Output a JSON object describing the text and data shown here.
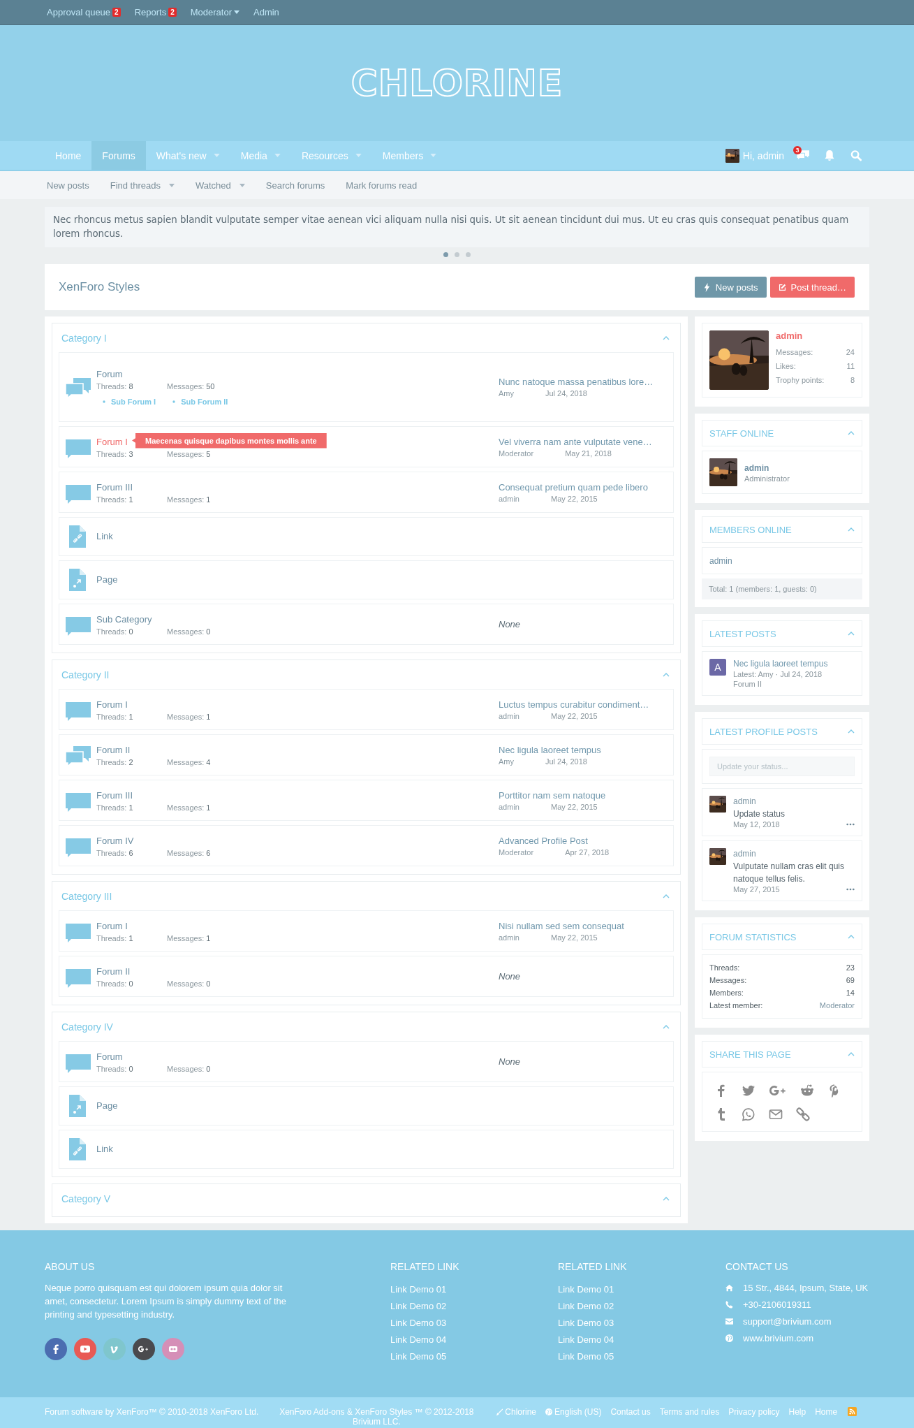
{
  "staff_bar": [
    {
      "label": "Approval queue",
      "badge": "2",
      "dropdown": false
    },
    {
      "label": "Reports",
      "badge": "2",
      "dropdown": false
    },
    {
      "label": "Moderator",
      "dropdown": true
    },
    {
      "label": "Admin",
      "dropdown": false
    }
  ],
  "logo": "CHLORINE",
  "nav": {
    "tabs": [
      {
        "label": "Home",
        "selected": false,
        "dropdown": false
      },
      {
        "label": "Forums",
        "selected": true,
        "dropdown": false
      },
      {
        "label": "What's new",
        "selected": false,
        "dropdown": true
      },
      {
        "label": "Media",
        "selected": false,
        "dropdown": true
      },
      {
        "label": "Resources",
        "selected": false,
        "dropdown": true
      },
      {
        "label": "Members",
        "selected": false,
        "dropdown": true
      }
    ],
    "user": "Hi, admin",
    "inbox_badge": "3"
  },
  "subnav": [
    {
      "label": "New posts",
      "dropdown": false
    },
    {
      "label": "Find threads",
      "dropdown": true
    },
    {
      "label": "Watched",
      "dropdown": true
    },
    {
      "label": "Search forums",
      "dropdown": false
    },
    {
      "label": "Mark forums read",
      "dropdown": false
    }
  ],
  "notice": {
    "text": "Nec rhoncus metus sapien blandit vulputate semper vitae aenean vici aliquam nulla nisi quis. Ut sit aenean tincidunt dui mus. Ut eu cras quis consequat penatibus quam lorem rhoncus.",
    "slides": [
      {
        "selected": true
      },
      {
        "selected": false
      },
      {
        "selected": false
      }
    ]
  },
  "page": {
    "title": "XenForo Styles",
    "buttons": [
      {
        "label": "New posts",
        "kind": "secondary"
      },
      {
        "label": "Post thread…",
        "kind": "primary"
      }
    ]
  },
  "categories": [
    {
      "title": "Category I",
      "nodes": [
        {
          "kind": "forum",
          "name": "Forum",
          "unread": true,
          "stats": [
            {
              "label": "Threads:",
              "value": "8"
            },
            {
              "label": "Messages:",
              "value": "50"
            }
          ],
          "subforums": [
            "Sub Forum I",
            "Sub Forum II"
          ],
          "last_post": {
            "kind": "post",
            "title": "Nunc natoque massa penatibus lore…",
            "user": "Amy",
            "date": "Jul 24, 2018"
          }
        },
        {
          "kind": "forum",
          "name": "Forum I",
          "unread": false,
          "tooltip": "Maecenas quisque dapibus montes mollis ante",
          "stats": [
            {
              "label": "Threads:",
              "value": "3"
            },
            {
              "label": "Messages:",
              "value": "5"
            }
          ],
          "last_post": {
            "kind": "post",
            "title": "Vel viverra nam ante vulputate vene…",
            "user": "Moderator",
            "date": "May 21, 2018"
          }
        },
        {
          "kind": "forum",
          "name": "Forum III",
          "unread": false,
          "stats": [
            {
              "label": "Threads:",
              "value": "1"
            },
            {
              "label": "Messages:",
              "value": "1"
            }
          ],
          "last_post": {
            "kind": "post",
            "title": "Consequat pretium quam pede libero",
            "user": "admin",
            "date": "May 22, 2015"
          }
        },
        {
          "kind": "link",
          "name": "Link"
        },
        {
          "kind": "page",
          "name": "Page"
        },
        {
          "kind": "forum",
          "name": "Sub Category",
          "unread": false,
          "stats": [
            {
              "label": "Threads:",
              "value": "0"
            },
            {
              "label": "Messages:",
              "value": "0"
            }
          ],
          "last_post": {
            "kind": "none",
            "text": "None"
          }
        }
      ]
    },
    {
      "title": "Category II",
      "nodes": [
        {
          "kind": "forum",
          "name": "Forum I",
          "unread": false,
          "stats": [
            {
              "label": "Threads:",
              "value": "1"
            },
            {
              "label": "Messages:",
              "value": "1"
            }
          ],
          "last_post": {
            "kind": "post",
            "title": "Luctus tempus curabitur condiment…",
            "user": "admin",
            "date": "May 22, 2015"
          }
        },
        {
          "kind": "forum",
          "name": "Forum II",
          "unread": true,
          "stats": [
            {
              "label": "Threads:",
              "value": "2"
            },
            {
              "label": "Messages:",
              "value": "4"
            }
          ],
          "last_post": {
            "kind": "post",
            "title": "Nec ligula laoreet tempus",
            "user": "Amy",
            "date": "Jul 24, 2018"
          }
        },
        {
          "kind": "forum",
          "name": "Forum III",
          "unread": false,
          "stats": [
            {
              "label": "Threads:",
              "value": "1"
            },
            {
              "label": "Messages:",
              "value": "1"
            }
          ],
          "last_post": {
            "kind": "post",
            "title": "Porttitor nam sem natoque",
            "user": "admin",
            "date": "May 22, 2015"
          }
        },
        {
          "kind": "forum",
          "name": "Forum IV",
          "unread": false,
          "stats": [
            {
              "label": "Threads:",
              "value": "6"
            },
            {
              "label": "Messages:",
              "value": "6"
            }
          ],
          "last_post": {
            "kind": "post",
            "title": "Advanced Profile Post",
            "user": "Moderator",
            "date": "Apr 27, 2018"
          }
        }
      ]
    },
    {
      "title": "Category III",
      "nodes": [
        {
          "kind": "forum",
          "name": "Forum I",
          "unread": false,
          "stats": [
            {
              "label": "Threads:",
              "value": "1"
            },
            {
              "label": "Messages:",
              "value": "1"
            }
          ],
          "last_post": {
            "kind": "post",
            "title": "Nisi nullam sed sem consequat",
            "user": "admin",
            "date": "May 22, 2015"
          }
        },
        {
          "kind": "forum",
          "name": "Forum II",
          "unread": false,
          "stats": [
            {
              "label": "Threads:",
              "value": "0"
            },
            {
              "label": "Messages:",
              "value": "0"
            }
          ],
          "last_post": {
            "kind": "none",
            "text": "None"
          }
        }
      ]
    },
    {
      "title": "Category IV",
      "nodes": [
        {
          "kind": "forum",
          "name": "Forum",
          "unread": false,
          "stats": [
            {
              "label": "Threads:",
              "value": "0"
            },
            {
              "label": "Messages:",
              "value": "0"
            }
          ],
          "last_post": {
            "kind": "none",
            "text": "None"
          }
        },
        {
          "kind": "page",
          "name": "Page"
        },
        {
          "kind": "link",
          "name": "Link"
        }
      ]
    },
    {
      "title": "Category V"
    }
  ],
  "sidebar": {
    "profile": {
      "name": "admin",
      "stats": [
        {
          "label": "Messages:",
          "value": "24"
        },
        {
          "label": "Likes:",
          "value": "11"
        },
        {
          "label": "Trophy points:",
          "value": "8"
        }
      ]
    },
    "widgets": [
      {
        "kind": "staff",
        "title": "STAFF ONLINE",
        "members": [
          {
            "name": "admin",
            "role": "Administrator"
          }
        ]
      },
      {
        "kind": "members",
        "title": "MEMBERS ONLINE",
        "names": [
          "admin"
        ],
        "total": "Total: 1 (members: 1, guests: 0)"
      },
      {
        "kind": "latest_posts",
        "title": "LATEST POSTS",
        "posts": [
          {
            "initial": "A",
            "color": "#6b68a6",
            "title": "Nec ligula laoreet tempus",
            "meta": "Latest: Amy · Jul 24, 2018",
            "forum": "Forum II"
          }
        ]
      },
      {
        "kind": "profile_posts",
        "title": "LATEST PROFILE POSTS",
        "placeholder": "Update your status...",
        "posts": [
          {
            "user": "admin",
            "text": "Update status",
            "date": "May 12, 2018"
          },
          {
            "user": "admin",
            "text": "Vulputate nullam cras elit quis natoque tellus felis.",
            "date": "May 27, 2015"
          }
        ]
      },
      {
        "kind": "stats",
        "title": "FORUM STATISTICS",
        "rows": [
          {
            "label": "Threads:",
            "value": "23"
          },
          {
            "label": "Messages:",
            "value": "69"
          },
          {
            "label": "Members:",
            "value": "14"
          },
          {
            "label": "Latest member:",
            "value": "Moderator"
          }
        ]
      },
      {
        "kind": "share",
        "title": "SHARE THIS PAGE"
      }
    ]
  },
  "footer": {
    "about": {
      "title": "ABOUT US",
      "text": "Neque porro quisquam est qui dolorem ipsum quia dolor sit amet, consectetur. Lorem Ipsum is simply dummy text of the printing and typesetting industry.",
      "social": [
        {
          "kind": "facebook",
          "color": "#4b6db0"
        },
        {
          "kind": "youtube",
          "color": "#e85a55"
        },
        {
          "kind": "vimeo",
          "color": "#7fc6cd"
        },
        {
          "kind": "googleplus",
          "color": "#4a4a4e"
        },
        {
          "kind": "flickr",
          "color": "#d58fb7"
        }
      ]
    },
    "link_columns": [
      {
        "title": "RELATED LINK",
        "links": [
          "Link Demo 01",
          "Link Demo 02",
          "Link Demo 03",
          "Link Demo 04",
          "Link Demo 05"
        ]
      },
      {
        "title": "RELATED LINK",
        "links": [
          "Link Demo 01",
          "Link Demo 02",
          "Link Demo 03",
          "Link Demo 04",
          "Link Demo 05"
        ]
      }
    ],
    "contact": {
      "title": "CONTACT US",
      "items": [
        {
          "kind": "address",
          "text": "15 Str., 4844, Ipsum, State, UK"
        },
        {
          "kind": "phone",
          "text": "+30-2106019311"
        },
        {
          "kind": "email",
          "text": "support@brivium.com"
        },
        {
          "kind": "web",
          "text": "www.brivium.com"
        }
      ]
    }
  },
  "bottom": {
    "copyright": "Forum software by XenForo™ © 2010-2018 XenForo Ltd.",
    "addons": "XenForo Add-ons & XenForo Styles ™ © 2012-2018 Brivium LLC.",
    "style": "Chlorine",
    "language": "English (US)",
    "links": [
      "Contact us",
      "Terms and rules",
      "Privacy policy",
      "Help",
      "Home"
    ]
  }
}
